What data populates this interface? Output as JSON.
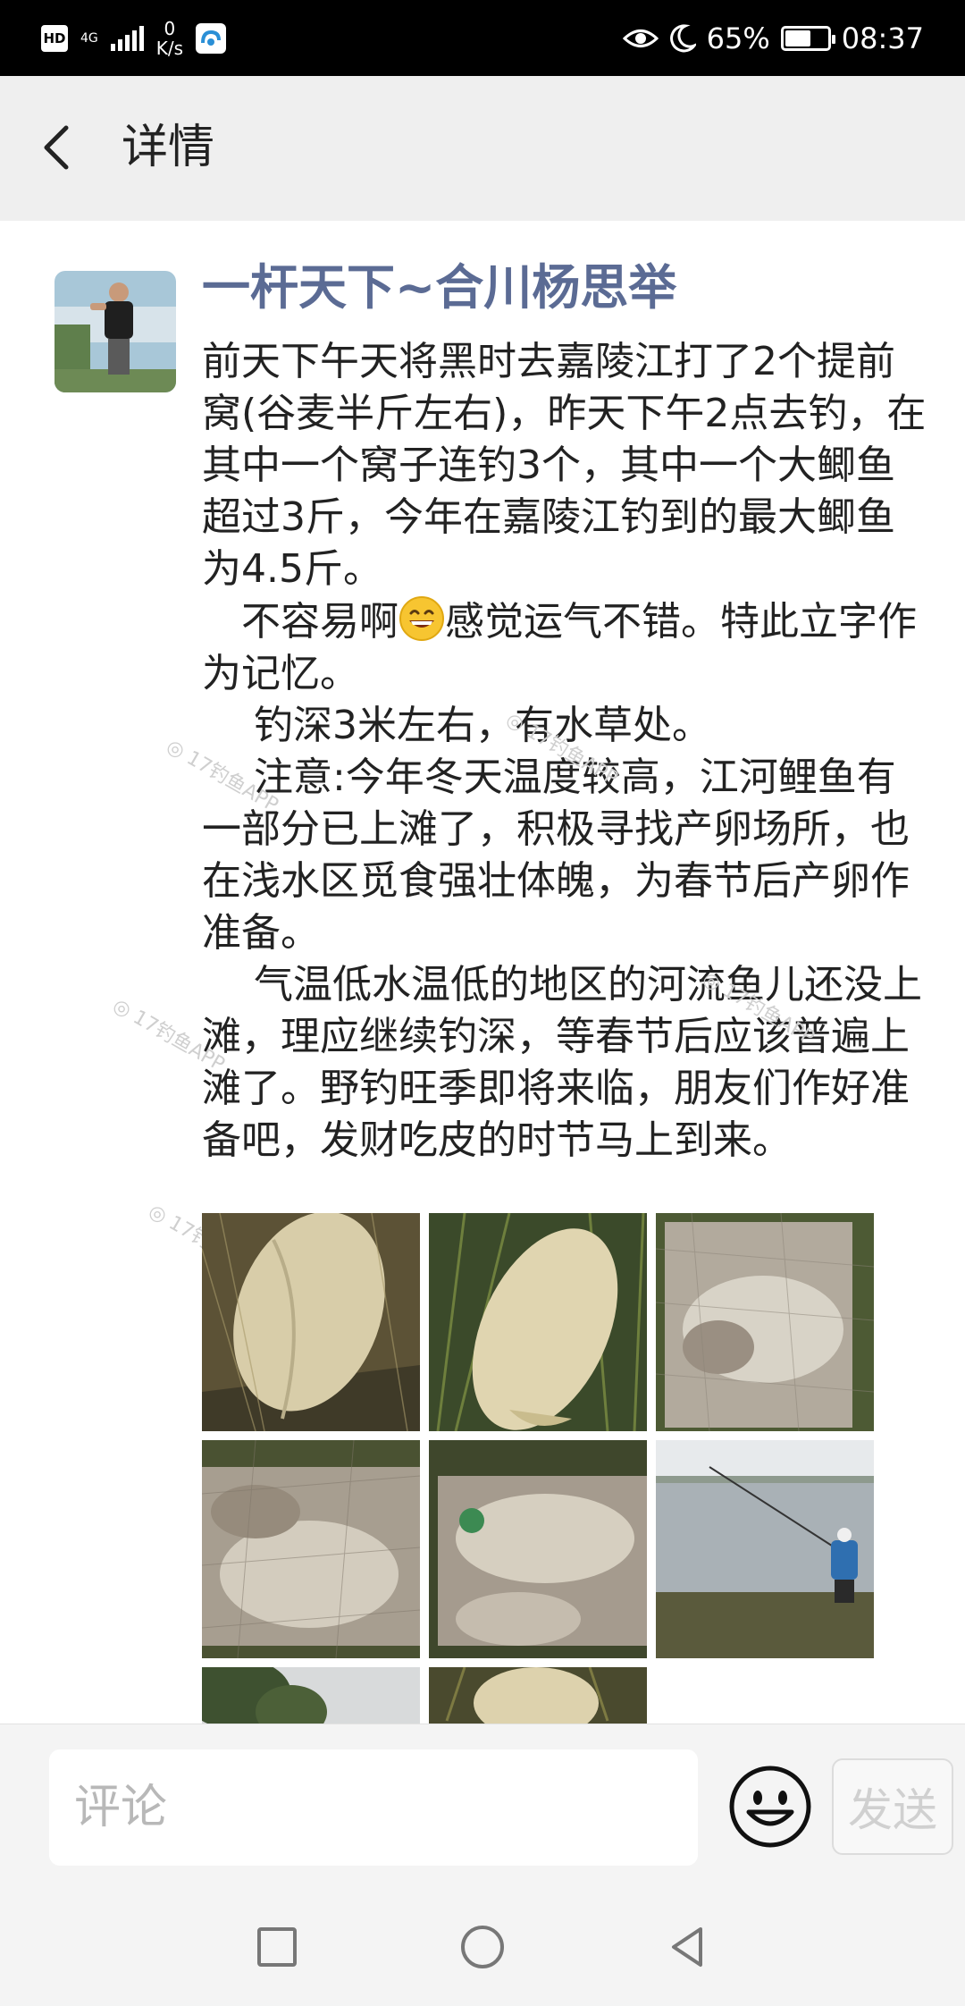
{
  "status_bar": {
    "hd": "HD",
    "network": "4G",
    "speed_value": "0",
    "speed_unit": "K/s",
    "battery": "65%",
    "battery_level": 0.65,
    "time": "08:37"
  },
  "header": {
    "title": "详情"
  },
  "post": {
    "author": "一杆天下~合川杨思举",
    "paragraphs": [
      {
        "text": "前天下午天将黑时去嘉陵江打了2个提前窝(谷麦半斤左右)，昨天下午2点去钓，在其中一个窝子连钓3个，其中一个大鲫鱼超过3斤，今年在嘉陵江钓到的最大鲫鱼为4.5斤。"
      },
      {
        "before_emoji": "　不容易啊",
        "after_emoji": "感觉运气不错。特此立字作为记忆。"
      },
      {
        "text": "　 钓深3米左右，有水草处。"
      },
      {
        "text": "　 注意:今年冬天温度较高，江河鲤鱼有一部分已上滩了，积极寻找产卵场所，也在浅水区觅食强壮体魄，为春节后产卵作准备。"
      },
      {
        "text": "　  气温低水温低的地区的河流鱼儿还没上滩，理应继续钓深，等春节后应该普遍上滩了。野钓旺季即将来临，朋友们作好准备吧，发财吃皮的时节马上到来。"
      }
    ],
    "emoji_icon": "grinning-face-emoji",
    "watermark_text": "17钓鱼APP",
    "images": [
      {
        "name": "photo-crucian-carp-on-grass-1"
      },
      {
        "name": "photo-crucian-carp-on-grass-2"
      },
      {
        "name": "photo-fish-in-net-1"
      },
      {
        "name": "photo-fish-in-net-2"
      },
      {
        "name": "photo-fish-in-net-3"
      },
      {
        "name": "photo-angler-at-river"
      },
      {
        "name": "photo-riverbank-trees"
      },
      {
        "name": "photo-crucian-carp-on-grass-3"
      }
    ]
  },
  "comment_bar": {
    "placeholder": "评论",
    "send_label": "发送"
  },
  "colors": {
    "author": "#5b6b94",
    "header_bg": "#efefef",
    "status_bg": "#000000"
  }
}
